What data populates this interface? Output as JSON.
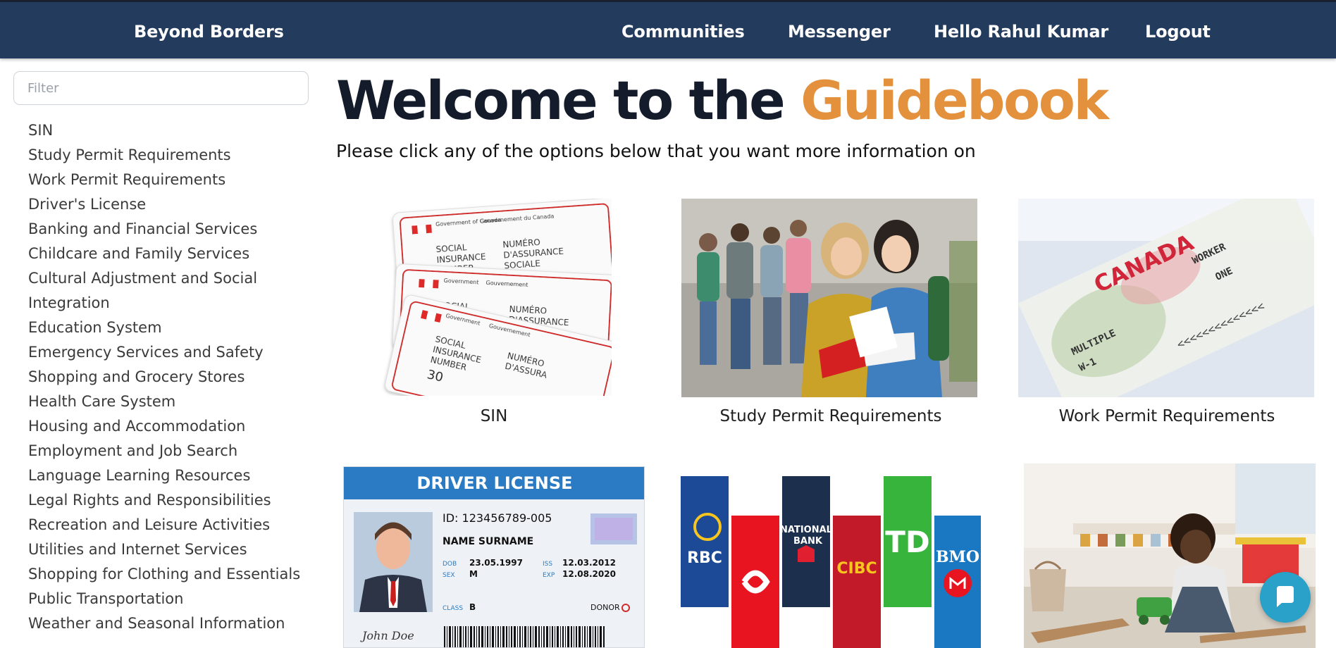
{
  "navbar": {
    "brand": "Beyond Borders",
    "links": [
      "Communities",
      "Messenger",
      "Hello Rahul Kumar",
      "Logout"
    ]
  },
  "sidebar": {
    "filter_placeholder": "Filter",
    "items": [
      "SIN",
      "Study Permit Requirements",
      "Work Permit Requirements",
      "Driver's License",
      "Banking and Financial Services",
      "Childcare and Family Services",
      "Cultural Adjustment and Social Integration",
      "Education System",
      "Emergency Services and Safety",
      "Shopping and Grocery Stores",
      "Health Care System",
      "Housing and Accommodation",
      "Employment and Job Search",
      "Language Learning Resources",
      "Legal Rights and Responsibilities",
      "Recreation and Leisure Activities",
      "Utilities and Internet Services",
      "Shopping for Clothing and Essentials",
      "Public Transportation",
      "Weather and Seasonal Information"
    ]
  },
  "main": {
    "title_prefix": "Welcome to the ",
    "title_highlight": "Guidebook",
    "subtitle": "Please click any of the options below that you want more information on",
    "cards": [
      {
        "label": "SIN"
      },
      {
        "label": "Study Permit Requirements"
      },
      {
        "label": "Work Permit Requirements"
      }
    ]
  },
  "images": {
    "sin_card": {
      "gov_en": "Government of Canada",
      "gov_fr": "Gouvernement du Canada",
      "en": "SOCIAL INSURANCE NUMBER",
      "fr": "NUMÉRO D'ASSURANCE SOCIALE",
      "number_fragment": "30"
    },
    "work_permit": {
      "country": "CANADA",
      "type": "WORKER",
      "entries": "MULTIPLE",
      "code": "W-1",
      "count": "ONE"
    },
    "driver_license": {
      "header": "DRIVER LICENSE",
      "id": "ID: 123456789-005",
      "name": "NAME SURNAME",
      "dob_label": "DOB",
      "dob": "23.05.1997",
      "sex_label": "SEX",
      "sex": "M",
      "iss_label": "ISS",
      "iss": "12.03.2012",
      "exp_label": "EXP",
      "exp": "12.08.2020",
      "class_label": "CLASS",
      "class": "B",
      "donor_label": "DONOR",
      "signature": "John Doe"
    },
    "banks": [
      "RBC",
      "NATIONAL BANK",
      "CIBC",
      "TD",
      "BMO"
    ]
  },
  "colors": {
    "navbar": "#233b5c",
    "highlight": "#e4913e",
    "title": "#141c2c",
    "chat": "#2aa1c9"
  },
  "icons": {
    "chat": "chat-bubble-icon"
  }
}
